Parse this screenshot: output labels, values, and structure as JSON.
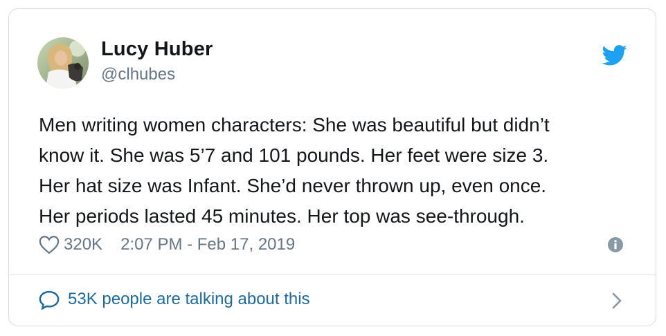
{
  "author": {
    "name": "Lucy Huber",
    "handle": "@clhubes"
  },
  "tweet": {
    "lines": [
      "Men writing women characters: She was beautiful but didn’t",
      "know it. She was 5’7 and 101 pounds. Her feet were size 3.",
      "Her hat size was Infant. She’d never thrown up, even once.",
      "Her periods lasted 45 minutes. Her top was see-through."
    ]
  },
  "meta": {
    "likes": "320K",
    "timestamp": "2:07 PM - Feb 17, 2019"
  },
  "footer": {
    "text": "53K people are talking about this"
  },
  "icons": {
    "brand": "twitter-bird-icon",
    "like": "heart-icon",
    "info": "info-icon",
    "reply": "speech-bubble-icon",
    "more": "chevron-right-icon"
  },
  "colors": {
    "brand_blue": "#1da1f2",
    "link_blue": "#1b6aa3",
    "muted_gray": "#657786",
    "text": "#14171a",
    "border": "#d7dde3"
  }
}
